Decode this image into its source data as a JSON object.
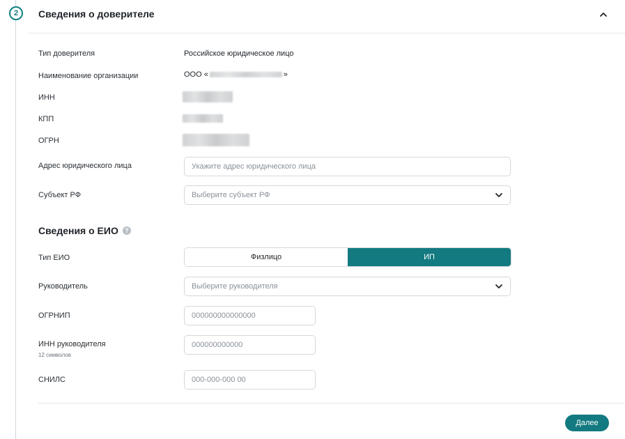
{
  "step": {
    "number": "2"
  },
  "section": {
    "title": "Сведения о доверителе"
  },
  "principal": {
    "type_label": "Тип доверителя",
    "type_value": "Российское юридическое лицо",
    "org_label": "Наименование организации",
    "org_prefix": "ООО «",
    "org_suffix": "»",
    "inn_label": "ИНН",
    "kpp_label": "КПП",
    "ogrn_label": "ОГРН",
    "address_label": "Адрес юридического лица",
    "address_placeholder": "Укажите адрес юридического лица",
    "region_label": "Субъект РФ",
    "region_placeholder": "Выберите субъект РФ"
  },
  "eio": {
    "title": "Сведения о ЕИО",
    "help_icon": "?",
    "type_label": "Тип ЕИО",
    "options": [
      "Физлицо",
      "ИП"
    ],
    "selected": "ИП",
    "manager_label": "Руководитель",
    "manager_placeholder": "Выберите руководителя",
    "ogrnip_label": "ОГРНИП",
    "ogrnip_placeholder": "000000000000000",
    "inn_label": "ИНН руководителя",
    "inn_hint": "12 символов",
    "inn_placeholder": "000000000000",
    "snils_label": "СНИЛС",
    "snils_placeholder": "000-000-000 00"
  },
  "footer": {
    "next_label": "Далее"
  },
  "colors": {
    "accent": "#127a80",
    "border": "#d3d8dd"
  },
  "icons": {
    "collapse": "chevron-up-icon",
    "dropdown": "chevron-down-icon",
    "help": "help-circle-icon"
  }
}
